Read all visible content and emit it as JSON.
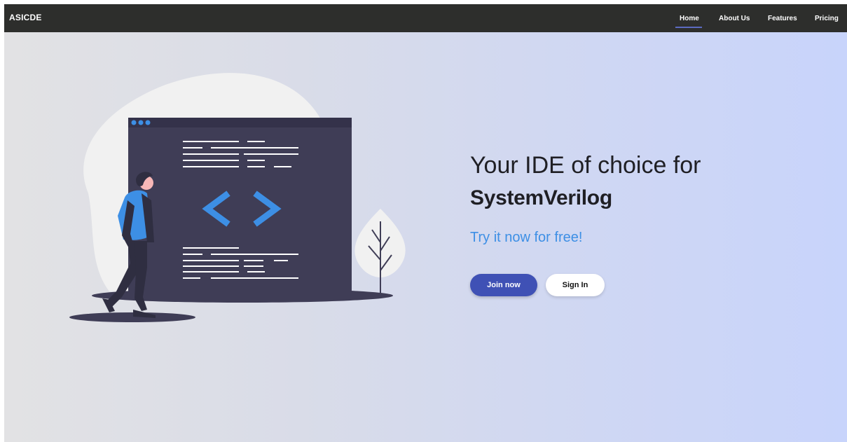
{
  "navbar": {
    "brand": "ASICDE",
    "items": [
      {
        "label": "Home",
        "active": true
      },
      {
        "label": "About Us",
        "active": false
      },
      {
        "label": "Features",
        "active": false
      },
      {
        "label": "Pricing",
        "active": false
      }
    ],
    "background": "#2d2e2c",
    "active_underline_color": "#5c6bc0"
  },
  "hero": {
    "headline": "Your IDE of choice for",
    "headline_strong": "SystemVerilog",
    "tagline": "Try it now for free!",
    "join_button": "Join now",
    "signin_button": "Sign In",
    "illustration": "developer-code-window-illustration"
  },
  "colors": {
    "accent": "#3f51b5",
    "tagline": "#3d8fe5",
    "code_brackets": "#3d8fe5",
    "window": "#3f3d56"
  }
}
